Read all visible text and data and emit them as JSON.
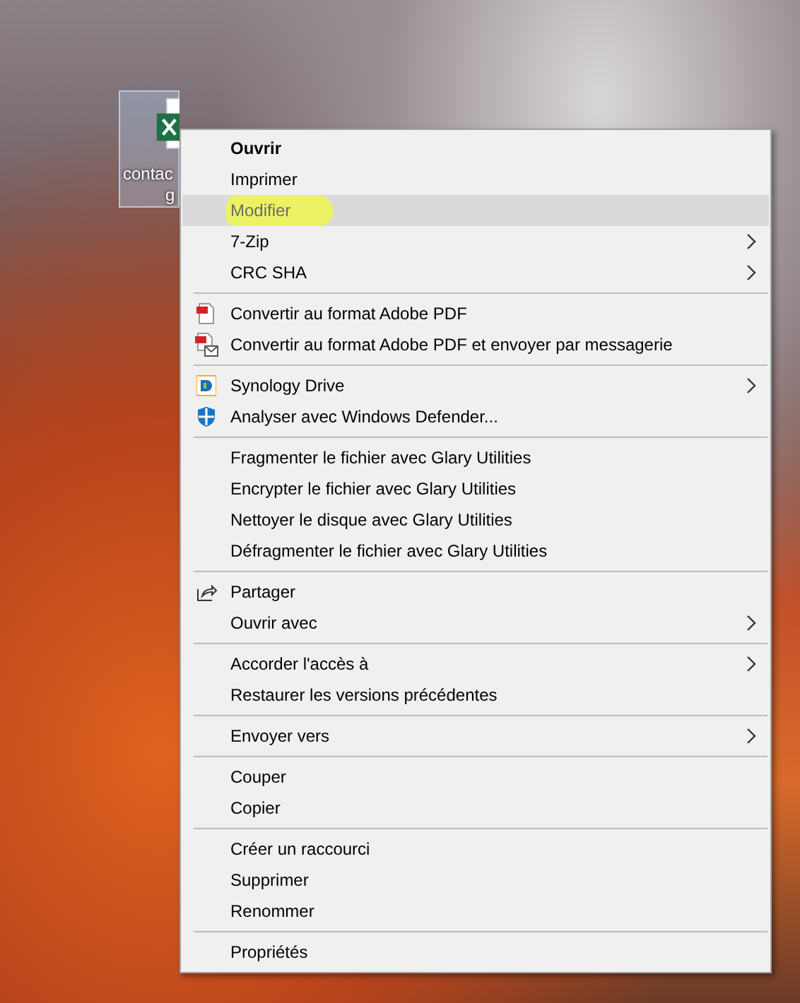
{
  "desktop_icon": {
    "label_lines": [
      "contac",
      "g"
    ],
    "selected": true
  },
  "context_menu": {
    "sections": [
      {
        "items": [
          {
            "label": "Ouvrir",
            "kind": "plain",
            "default": true,
            "highlighted": false,
            "disabled": false,
            "marked": false,
            "submenu": false
          },
          {
            "label": "Imprimer",
            "kind": "plain",
            "default": false,
            "highlighted": false,
            "disabled": false,
            "marked": false,
            "submenu": false
          },
          {
            "label": "Modifier",
            "kind": "plain",
            "default": false,
            "highlighted": true,
            "disabled": true,
            "marked": true,
            "submenu": false
          },
          {
            "label": "7-Zip",
            "kind": "plain",
            "default": false,
            "highlighted": false,
            "disabled": false,
            "marked": false,
            "submenu": true
          },
          {
            "label": "CRC SHA",
            "kind": "plain",
            "default": false,
            "highlighted": false,
            "disabled": false,
            "marked": false,
            "submenu": true
          }
        ]
      },
      {
        "items": [
          {
            "label": "Convertir au format Adobe PDF",
            "kind": "pdf",
            "default": false,
            "highlighted": false,
            "disabled": false,
            "marked": false,
            "submenu": false
          },
          {
            "label": "Convertir au format Adobe PDF et envoyer par messagerie",
            "kind": "pdf-mail",
            "default": false,
            "highlighted": false,
            "disabled": false,
            "marked": false,
            "submenu": false
          }
        ]
      },
      {
        "items": [
          {
            "label": "Synology Drive",
            "kind": "synology",
            "default": false,
            "highlighted": false,
            "disabled": false,
            "marked": false,
            "submenu": true
          },
          {
            "label": "Analyser avec Windows Defender...",
            "kind": "shield",
            "default": false,
            "highlighted": false,
            "disabled": false,
            "marked": false,
            "submenu": false
          }
        ]
      },
      {
        "items": [
          {
            "label": "Fragmenter le fichier avec Glary Utilities",
            "kind": "plain",
            "default": false,
            "highlighted": false,
            "disabled": false,
            "marked": false,
            "submenu": false
          },
          {
            "label": "Encrypter le fichier avec Glary Utilities",
            "kind": "plain",
            "default": false,
            "highlighted": false,
            "disabled": false,
            "marked": false,
            "submenu": false
          },
          {
            "label": "Nettoyer le disque avec Glary Utilities",
            "kind": "plain",
            "default": false,
            "highlighted": false,
            "disabled": false,
            "marked": false,
            "submenu": false
          },
          {
            "label": "Défragmenter le fichier avec Glary Utilities",
            "kind": "plain",
            "default": false,
            "highlighted": false,
            "disabled": false,
            "marked": false,
            "submenu": false
          }
        ]
      },
      {
        "items": [
          {
            "label": "Partager",
            "kind": "share",
            "default": false,
            "highlighted": false,
            "disabled": false,
            "marked": false,
            "submenu": false
          },
          {
            "label": "Ouvrir avec",
            "kind": "plain",
            "default": false,
            "highlighted": false,
            "disabled": false,
            "marked": false,
            "submenu": true
          }
        ]
      },
      {
        "items": [
          {
            "label": "Accorder l'accès à",
            "kind": "plain",
            "default": false,
            "highlighted": false,
            "disabled": false,
            "marked": false,
            "submenu": true
          },
          {
            "label": "Restaurer les versions précédentes",
            "kind": "plain",
            "default": false,
            "highlighted": false,
            "disabled": false,
            "marked": false,
            "submenu": false
          }
        ]
      },
      {
        "items": [
          {
            "label": "Envoyer vers",
            "kind": "plain",
            "default": false,
            "highlighted": false,
            "disabled": false,
            "marked": false,
            "submenu": true
          }
        ]
      },
      {
        "items": [
          {
            "label": "Couper",
            "kind": "plain",
            "default": false,
            "highlighted": false,
            "disabled": false,
            "marked": false,
            "submenu": false
          },
          {
            "label": "Copier",
            "kind": "plain",
            "default": false,
            "highlighted": false,
            "disabled": false,
            "marked": false,
            "submenu": false
          }
        ]
      },
      {
        "items": [
          {
            "label": "Créer un raccourci",
            "kind": "plain",
            "default": false,
            "highlighted": false,
            "disabled": false,
            "marked": false,
            "submenu": false
          },
          {
            "label": "Supprimer",
            "kind": "plain",
            "default": false,
            "highlighted": false,
            "disabled": false,
            "marked": false,
            "submenu": false
          },
          {
            "label": "Renommer",
            "kind": "plain",
            "default": false,
            "highlighted": false,
            "disabled": false,
            "marked": false,
            "submenu": false
          }
        ]
      },
      {
        "items": [
          {
            "label": "Propriétés",
            "kind": "plain",
            "default": false,
            "highlighted": false,
            "disabled": false,
            "marked": false,
            "submenu": false
          }
        ]
      }
    ]
  }
}
